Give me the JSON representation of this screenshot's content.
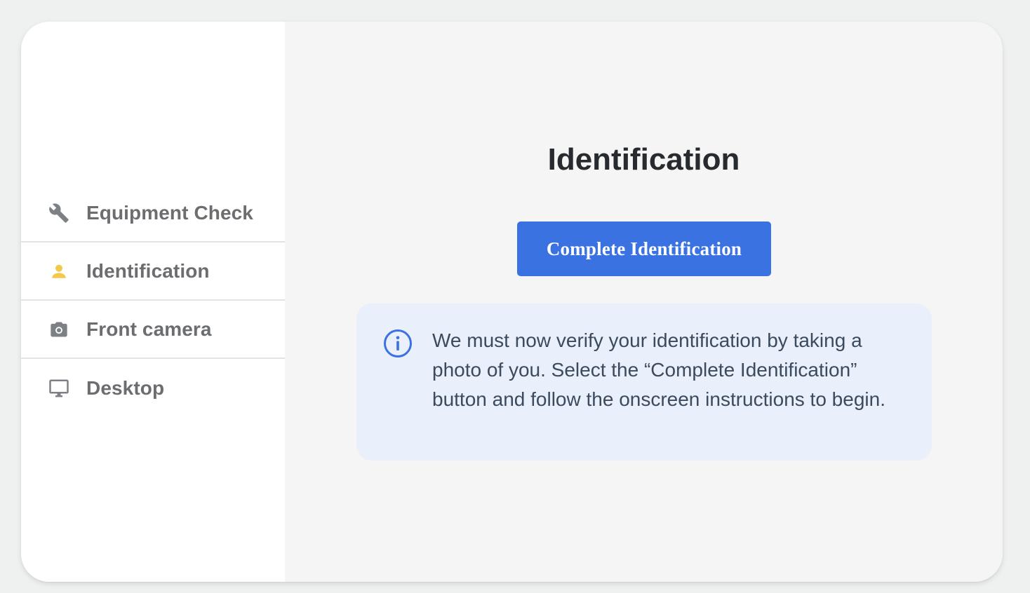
{
  "sidebar": {
    "items": [
      {
        "label": "Equipment Check",
        "icon": "wrench-icon",
        "color": "#7d8185"
      },
      {
        "label": "Identification",
        "icon": "user-icon",
        "color": "#f2c94c",
        "active": true
      },
      {
        "label": "Front camera",
        "icon": "camera-icon",
        "color": "#7d8185"
      },
      {
        "label": "Desktop",
        "icon": "monitor-icon",
        "color": "#7d8185"
      }
    ]
  },
  "main": {
    "title": "Identification",
    "button_label": "Complete Identification",
    "info": {
      "icon": "info-icon",
      "text": "We must now verify your identification by taking a photo of you. Select the “Complete Identification” button and follow the onscreen instructions to begin."
    }
  },
  "colors": {
    "accent": "#3a72e2",
    "info_background": "#e9effb",
    "active_icon": "#f2c94c"
  }
}
